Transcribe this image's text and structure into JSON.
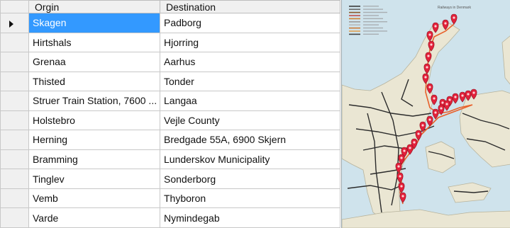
{
  "grid": {
    "columns": [
      "Orgin",
      "Destination"
    ],
    "selected_row": 0,
    "rows": [
      {
        "origin": "Skagen",
        "destination": "Padborg"
      },
      {
        "origin": "Hirtshals",
        "destination": "Hjorring"
      },
      {
        "origin": "Grenaa",
        "destination": "Aarhus"
      },
      {
        "origin": "Thisted",
        "destination": "Tonder"
      },
      {
        "origin": "Struer Train Station, 7600 ...",
        "destination": "Langaa"
      },
      {
        "origin": "Holstebro",
        "destination": "Vejle County"
      },
      {
        "origin": "Herning",
        "destination": "Bredgade 55A, 6900 Skjern"
      },
      {
        "origin": "Bramming",
        "destination": "Lunderskov Municipality"
      },
      {
        "origin": "Tinglev",
        "destination": "Sonderborg"
      },
      {
        "origin": "Vemb",
        "destination": "Thyboron"
      },
      {
        "origin": "Varde",
        "destination": "Nymindegab"
      }
    ]
  },
  "map": {
    "title": "Railways in Denmark",
    "colors": {
      "water": "#cfe3ec",
      "land": "#eae6d3",
      "rail": "#2b2b2b",
      "route": "#e8622d",
      "marker": "#e2213a"
    },
    "legend_colors": [
      "#3a3a3a",
      "#6a6a6a",
      "#8a5a2a",
      "#c0504d",
      "#d08030",
      "#9a9a9a",
      "#b8b8b8",
      "#cc7733",
      "#e0a050",
      "#444444"
    ]
  }
}
